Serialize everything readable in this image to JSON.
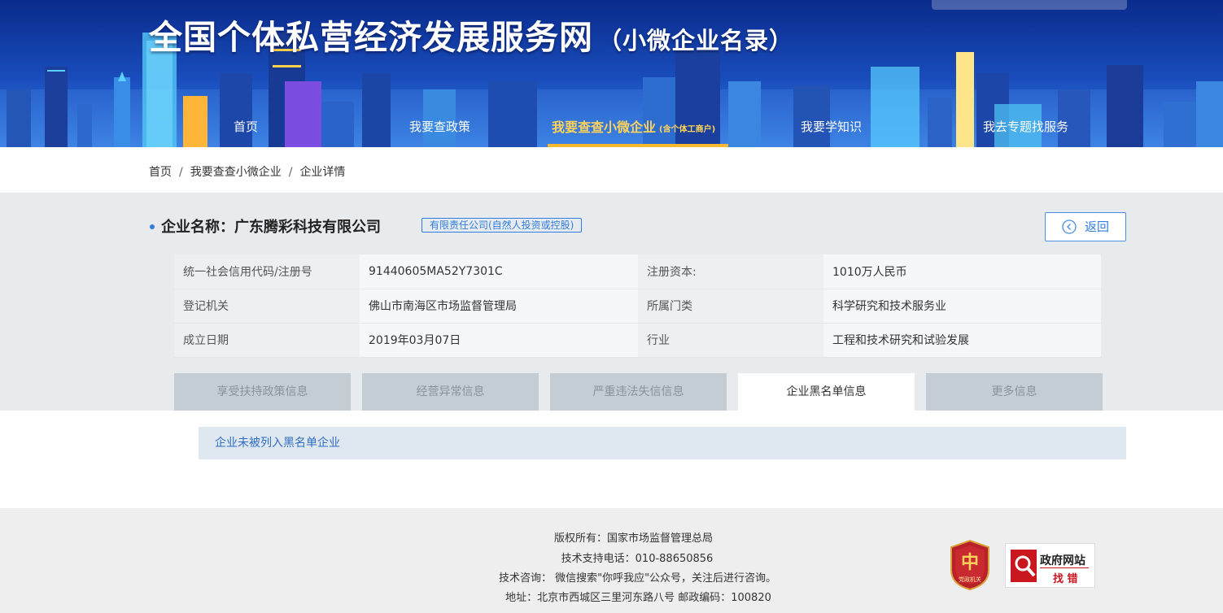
{
  "header": {
    "title": "全国个体私营经济发展服务网",
    "subtitle": "（小微企业名录）"
  },
  "nav": {
    "items": [
      {
        "label": "首页"
      },
      {
        "label": "我要查政策"
      },
      {
        "label": "我要查查小微企业",
        "sub": "(含个体工商户)",
        "active": true
      },
      {
        "label": "我要学知识"
      },
      {
        "label": "我去专题找服务"
      }
    ]
  },
  "breadcrumb": {
    "items": [
      "首页",
      "我要查查小微企业",
      "企业详情"
    ],
    "separator": "/"
  },
  "company": {
    "name_label": "企业名称：",
    "name": "广东腾彩科技有限公司",
    "type": "有限责任公司(自然人投资或控股)",
    "back_label": "返回"
  },
  "info_table": {
    "rows": [
      {
        "l1": "统一社会信用代码/注册号",
        "v1": "91440605MA52Y7301C",
        "l2": "注册资本:",
        "v2": "1010万人民币"
      },
      {
        "l1": "登记机关",
        "v1": "佛山市南海区市场监督管理局",
        "l2": "所属门类",
        "v2": "科学研究和技术服务业"
      },
      {
        "l1": "成立日期",
        "v1": "2019年03月07日",
        "l2": "行业",
        "v2": "工程和技术研究和试验发展"
      }
    ]
  },
  "tabs": {
    "items": [
      {
        "label": "享受扶持政策信息"
      },
      {
        "label": "经营异常信息"
      },
      {
        "label": "严重违法失信信息"
      },
      {
        "label": "企业黑名单信息",
        "active": true
      },
      {
        "label": "更多信息"
      }
    ]
  },
  "result": {
    "text": "企业未被列入黑名单企业"
  },
  "footer": {
    "copyright": "版权所有：国家市场监督管理总局",
    "phone": "技术支持电话：010-88650856",
    "consult": "技术咨询： 微信搜索\"你呼我应\"公众号，关注后进行咨询。",
    "address": "地址：北京市西城区三里河东路八号 邮政编码：100820",
    "party_badge_text": "党政机关",
    "gov_badge_title": "政府网站",
    "gov_badge_sub": "找 错"
  },
  "colors": {
    "accent_blue": "#2f7de0",
    "nav_active": "#ffd35a",
    "nav_underline": "#f5b82e",
    "tab_inactive": "#c4ccd4",
    "info_bg": "#e7ebee",
    "party_red": "#b8202a"
  },
  "icons": {
    "back": "back-arrow-circle-icon",
    "party": "party-emblem-icon",
    "gov": "gov-search-icon"
  }
}
